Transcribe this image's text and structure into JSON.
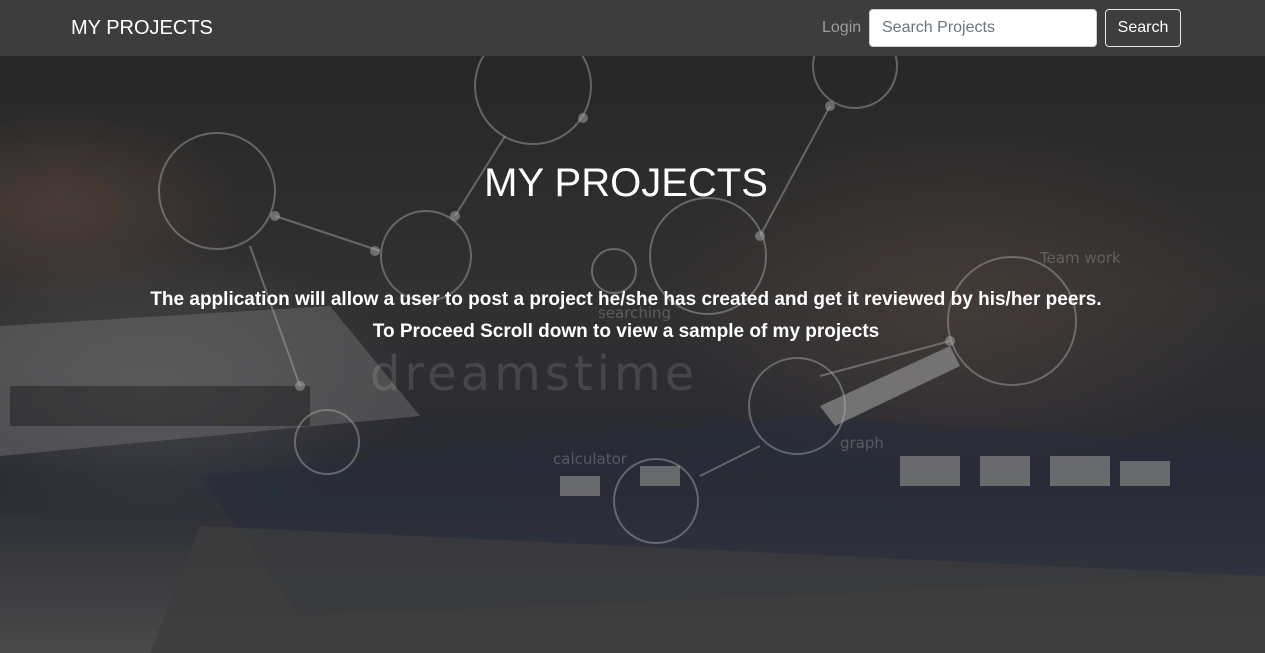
{
  "navbar": {
    "brand": "MY PROJECTS",
    "login_label": "Login",
    "search_placeholder": "Search Projects",
    "search_button_label": "Search"
  },
  "hero": {
    "title": "MY PROJECTS",
    "line1": "The application will allow a user to post a project he/she has created and get it reviewed by his/her peers.",
    "line2": "To Proceed Scroll down to view a sample of my projects",
    "background_overlay_labels": [
      "Team work",
      "searching",
      "calculator",
      "graph"
    ],
    "watermark": "dreamstime"
  },
  "colors": {
    "navbar_bg": "#3d3d3d",
    "login_link": "#9c9c9c",
    "hero_text": "#ffffff"
  }
}
